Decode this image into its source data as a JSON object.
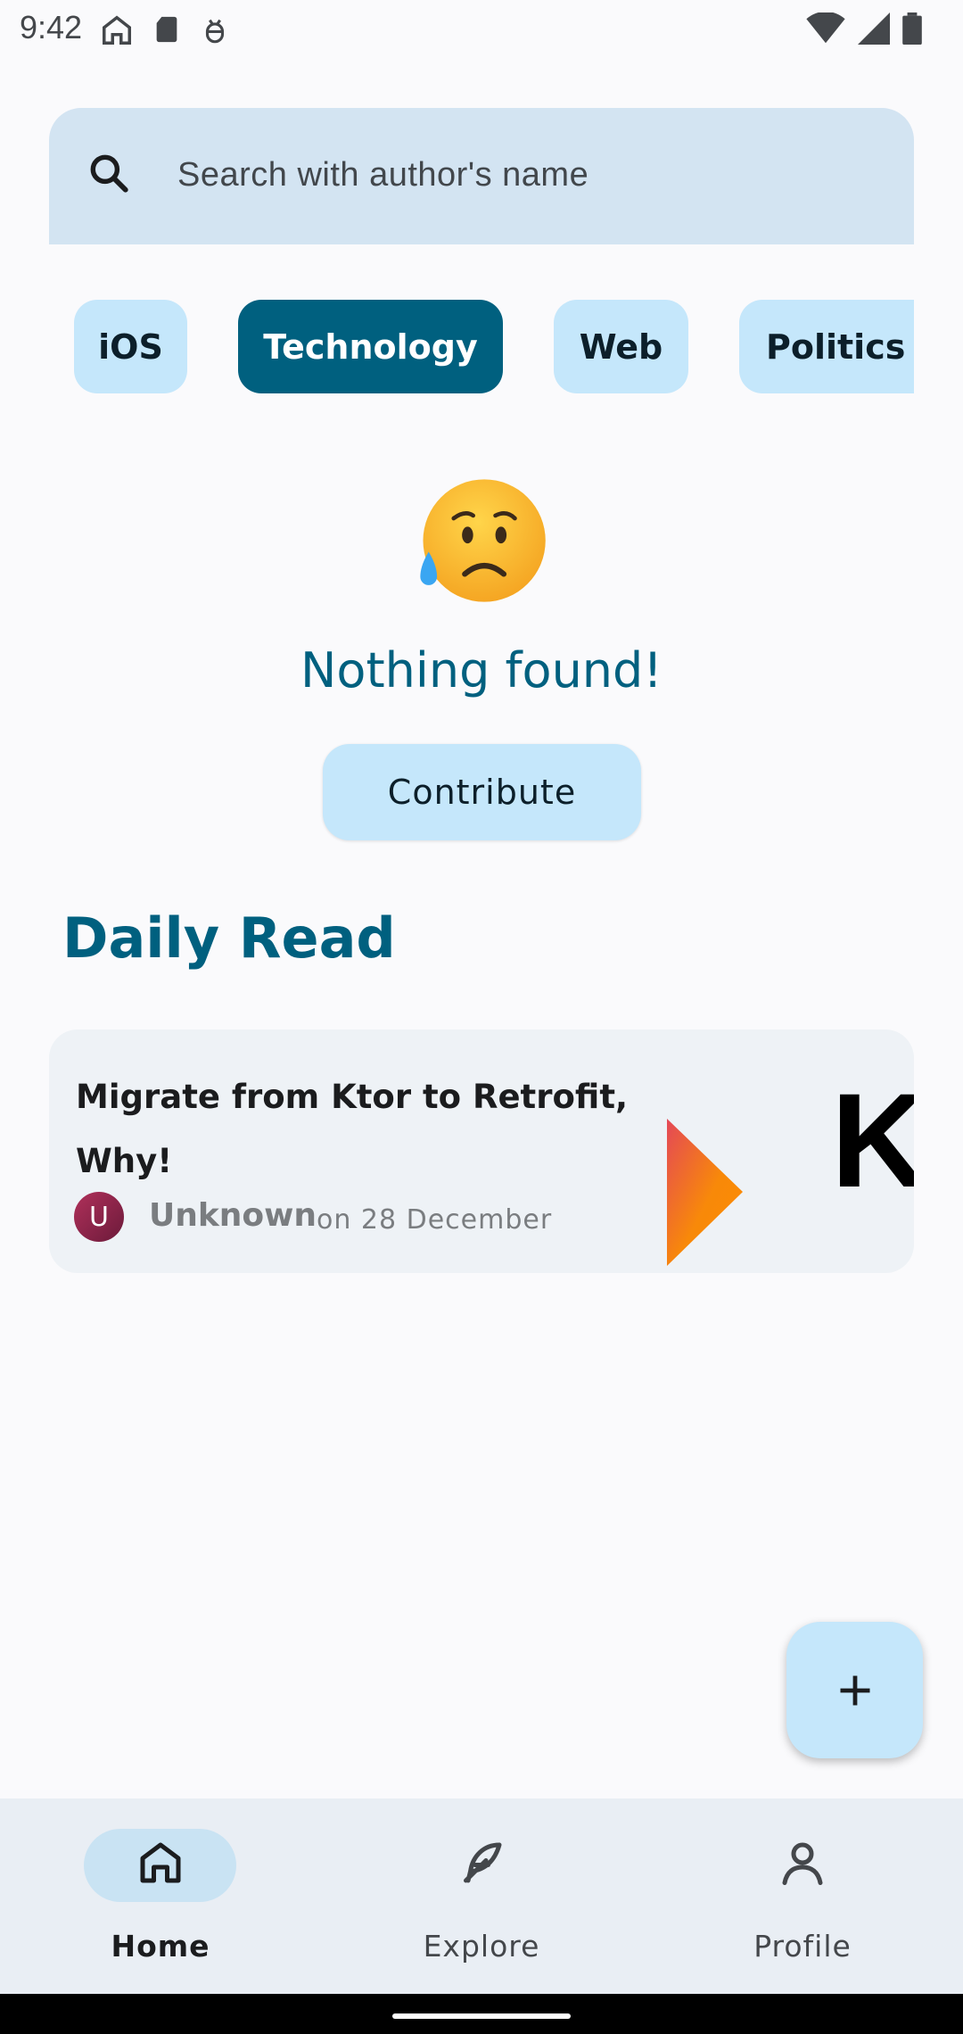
{
  "status_bar": {
    "time": "9:42",
    "left_icons": [
      "home-icon",
      "sd-card-icon",
      "debug-icon"
    ],
    "right_icons": [
      "wifi-icon",
      "signal-icon",
      "battery-icon"
    ]
  },
  "search": {
    "placeholder": "Search with author's name"
  },
  "chips": [
    {
      "label": "iOS",
      "selected": false
    },
    {
      "label": "Technology",
      "selected": true
    },
    {
      "label": "Web",
      "selected": false
    },
    {
      "label": "Politics",
      "selected": false
    }
  ],
  "empty_state": {
    "emoji": "sad-but-relieved-face",
    "title": "Nothing found!",
    "button_label": "Contribute"
  },
  "daily_read": {
    "section_title": "Daily Read",
    "card": {
      "title": "Migrate from Ktor to Retrofit, Why!",
      "avatar_initial": "U",
      "author": "Unknown",
      "date": "on 28 December",
      "thumbnail_text": "Kt"
    }
  },
  "fab": {
    "icon": "plus-icon"
  },
  "bottom_nav": [
    {
      "label": "Home",
      "icon": "home-icon",
      "active": true
    },
    {
      "label": "Explore",
      "icon": "feather-icon",
      "active": false
    },
    {
      "label": "Profile",
      "icon": "person-icon",
      "active": false
    }
  ],
  "colors": {
    "accent": "#00607f",
    "chip_bg": "#c5e7fb",
    "search_bg": "#d3e4f2",
    "nav_bg": "#e9eef4"
  }
}
